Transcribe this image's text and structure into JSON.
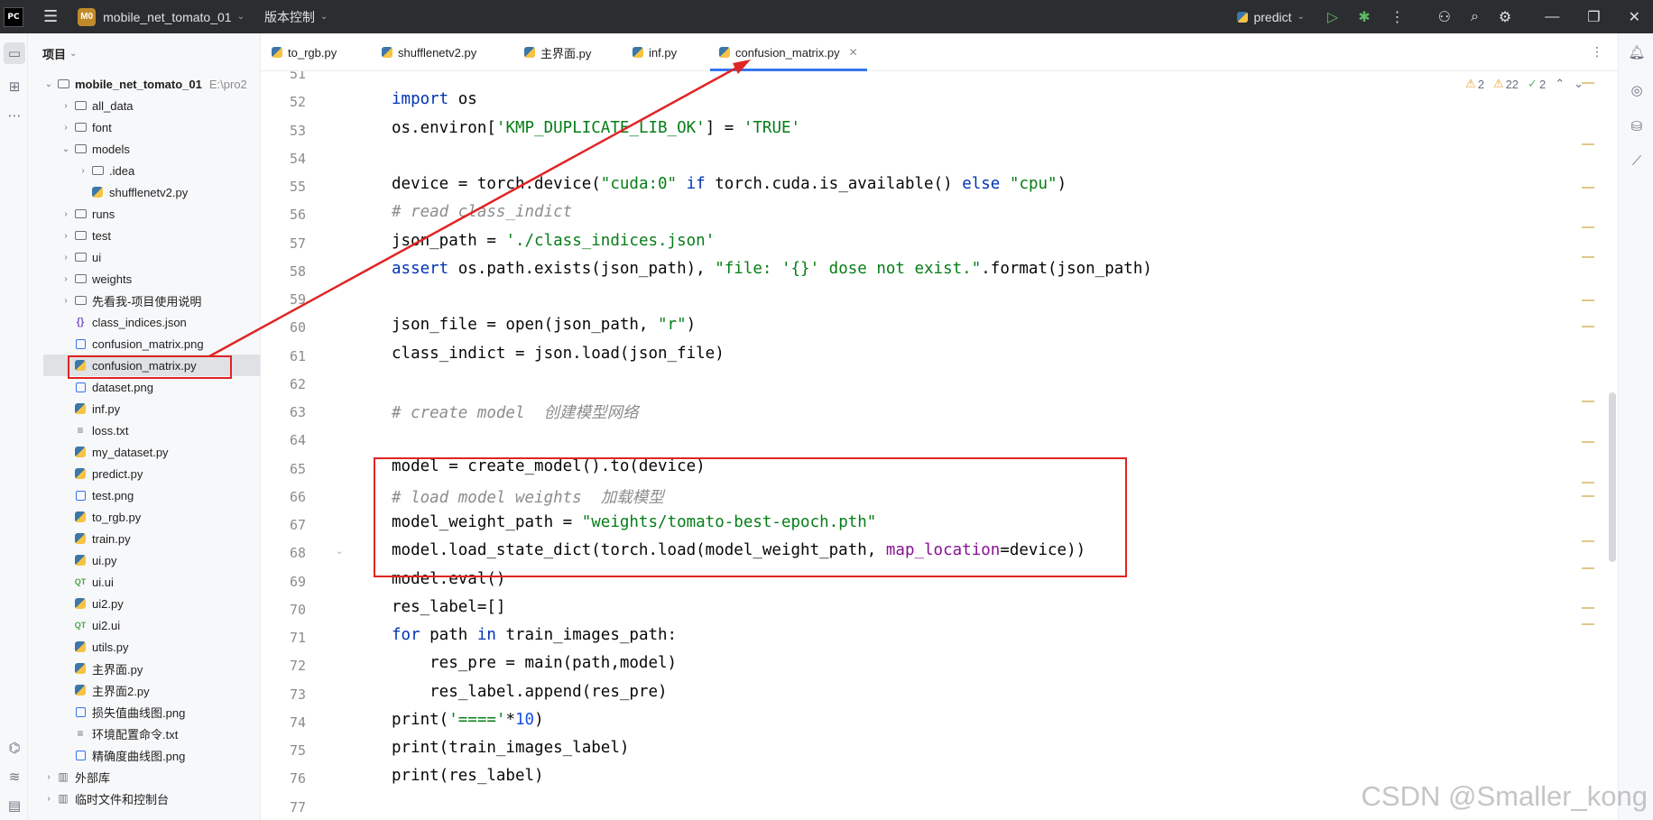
{
  "titlebar": {
    "app_logo": "PC",
    "project_badge": "M0",
    "project_name": "mobile_net_tomato_01",
    "vcs_label": "版本控制",
    "run_config": "predict"
  },
  "project_panel": {
    "title": "项目",
    "tree": [
      {
        "label": "mobile_net_tomato_01",
        "path": "E:\\pro2",
        "type": "folder",
        "arrow": "v",
        "bold": true
      },
      {
        "label": "all_data",
        "type": "folder",
        "arrow": ">"
      },
      {
        "label": "font",
        "type": "folder",
        "arrow": ">"
      },
      {
        "label": "models",
        "type": "folder",
        "arrow": "v"
      },
      {
        "label": ".idea",
        "type": "folder",
        "arrow": ">"
      },
      {
        "label": "shufflenetv2.py",
        "type": "py"
      },
      {
        "label": "runs",
        "type": "folder",
        "arrow": ">"
      },
      {
        "label": "test",
        "type": "folder",
        "arrow": ">"
      },
      {
        "label": "ui",
        "type": "folder",
        "arrow": ">"
      },
      {
        "label": "weights",
        "type": "folder",
        "arrow": ">"
      },
      {
        "label": "先看我-项目使用说明",
        "type": "folder",
        "arrow": ">"
      },
      {
        "label": "class_indices.json",
        "type": "json"
      },
      {
        "label": "confusion_matrix.png",
        "type": "img"
      },
      {
        "label": "confusion_matrix.py",
        "type": "py",
        "selected": true
      },
      {
        "label": "dataset.png",
        "type": "img"
      },
      {
        "label": "inf.py",
        "type": "py"
      },
      {
        "label": "loss.txt",
        "type": "txt"
      },
      {
        "label": "my_dataset.py",
        "type": "py"
      },
      {
        "label": "predict.py",
        "type": "py"
      },
      {
        "label": "test.png",
        "type": "img"
      },
      {
        "label": "to_rgb.py",
        "type": "py"
      },
      {
        "label": "train.py",
        "type": "py"
      },
      {
        "label": "ui.py",
        "type": "py"
      },
      {
        "label": "ui.ui",
        "type": "qt"
      },
      {
        "label": "ui2.py",
        "type": "py"
      },
      {
        "label": "ui2.ui",
        "type": "qt"
      },
      {
        "label": "utils.py",
        "type": "py"
      },
      {
        "label": "主界面.py",
        "type": "py"
      },
      {
        "label": "主界面2.py",
        "type": "py"
      },
      {
        "label": "损失值曲线图.png",
        "type": "img"
      },
      {
        "label": "环境配置命令.txt",
        "type": "txt"
      },
      {
        "label": "精确度曲线图.png",
        "type": "img"
      },
      {
        "label": "外部库",
        "type": "lib",
        "arrow": ">"
      },
      {
        "label": "临时文件和控制台",
        "type": "lib",
        "arrow": ">"
      }
    ]
  },
  "tabs": [
    {
      "label": "to_rgb.py"
    },
    {
      "label": "shufflenetv2.py"
    },
    {
      "label": "主界面.py"
    },
    {
      "label": "inf.py"
    },
    {
      "label": "confusion_matrix.py",
      "active": true
    }
  ],
  "inspections": {
    "warnings": "2",
    "weak_warnings": "22",
    "ok": "2"
  },
  "editor": {
    "line_numbers": [
      "51",
      "52",
      "53",
      "54",
      "55",
      "56",
      "57",
      "58",
      "59",
      "60",
      "61",
      "62",
      "63",
      "64",
      "65",
      "66",
      "67",
      "68",
      "69",
      "70",
      "71",
      "72",
      "73",
      "74",
      "75",
      "76",
      "77"
    ],
    "code_lines": [
      "",
      "import os",
      "os.environ['KMP_DUPLICATE_LIB_OK'] = 'TRUE'",
      "",
      "device = torch.device(\"cuda:0\" if torch.cuda.is_available() else \"cpu\")",
      "# read class_indict",
      "json_path = './class_indices.json'",
      "assert os.path.exists(json_path), \"file: '{}' dose not exist.\".format(json_path)",
      "",
      "json_file = open(json_path, \"r\")",
      "class_indict = json.load(json_file)",
      "",
      "# create model  创建模型网络",
      "",
      "model = create_model().to(device)",
      "# load model weights  加载模型",
      "model_weight_path = \"weights/tomato-best-epoch.pth\"",
      "model.load_state_dict(torch.load(model_weight_path, map_location=device))",
      "model.eval()",
      "res_label=[]",
      "for path in train_images_path:",
      "    res_pre = main(path,model)",
      "    res_label.append(res_pre)",
      "print('===='*10)",
      "print(train_images_label)",
      "print(res_label)",
      ""
    ]
  },
  "colors": {
    "accent": "#3574f0",
    "annotation": "#e02424",
    "keyword": "#0033b3",
    "string": "#067d17",
    "comment": "#8c8c8c"
  },
  "watermark": "CSDN @Smaller_kong"
}
